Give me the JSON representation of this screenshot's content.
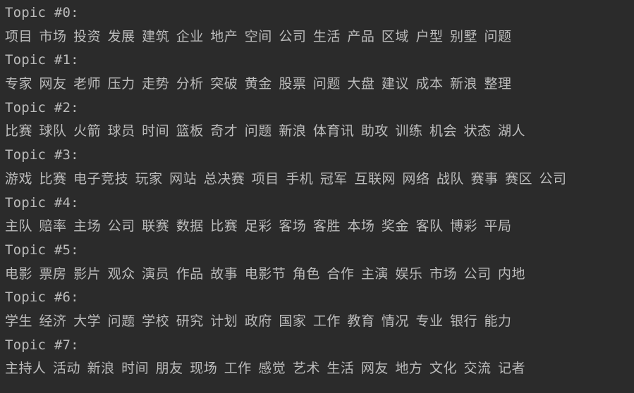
{
  "console": {
    "background": "#2b2b2b",
    "text_color": "#bbbbbb",
    "topics": [
      {
        "header": "Topic #0:",
        "words": "项目 市场 投资 发展 建筑 企业 地产 空间 公司 生活 产品 区域 户型 别墅 问题"
      },
      {
        "header": "Topic #1:",
        "words": "专家 网友 老师 压力 走势 分析 突破 黄金 股票 问题 大盘 建议 成本 新浪 整理"
      },
      {
        "header": "Topic #2:",
        "words": "比赛 球队 火箭 球员 时间 篮板 奇才 问题 新浪 体育讯 助攻 训练 机会 状态 湖人"
      },
      {
        "header": "Topic #3:",
        "words": "游戏 比赛 电子竞技 玩家 网站 总决赛 项目 手机 冠军 互联网 网络 战队 赛事 赛区 公司"
      },
      {
        "header": "Topic #4:",
        "words": "主队 赔率 主场 公司 联赛 数据 比赛 足彩 客场 客胜 本场 奖金 客队 博彩 平局"
      },
      {
        "header": "Topic #5:",
        "words": "电影 票房 影片 观众 演员 作品 故事 电影节 角色 合作 主演 娱乐 市场 公司 内地"
      },
      {
        "header": "Topic #6:",
        "words": "学生 经济 大学 问题 学校 研究 计划 政府 国家 工作 教育 情况 专业 银行 能力"
      },
      {
        "header": "Topic #7:",
        "words": "主持人 活动 新浪 时间 朋友 现场 工作 感觉 艺术 生活 网友 地方 文化 交流 记者"
      }
    ]
  }
}
